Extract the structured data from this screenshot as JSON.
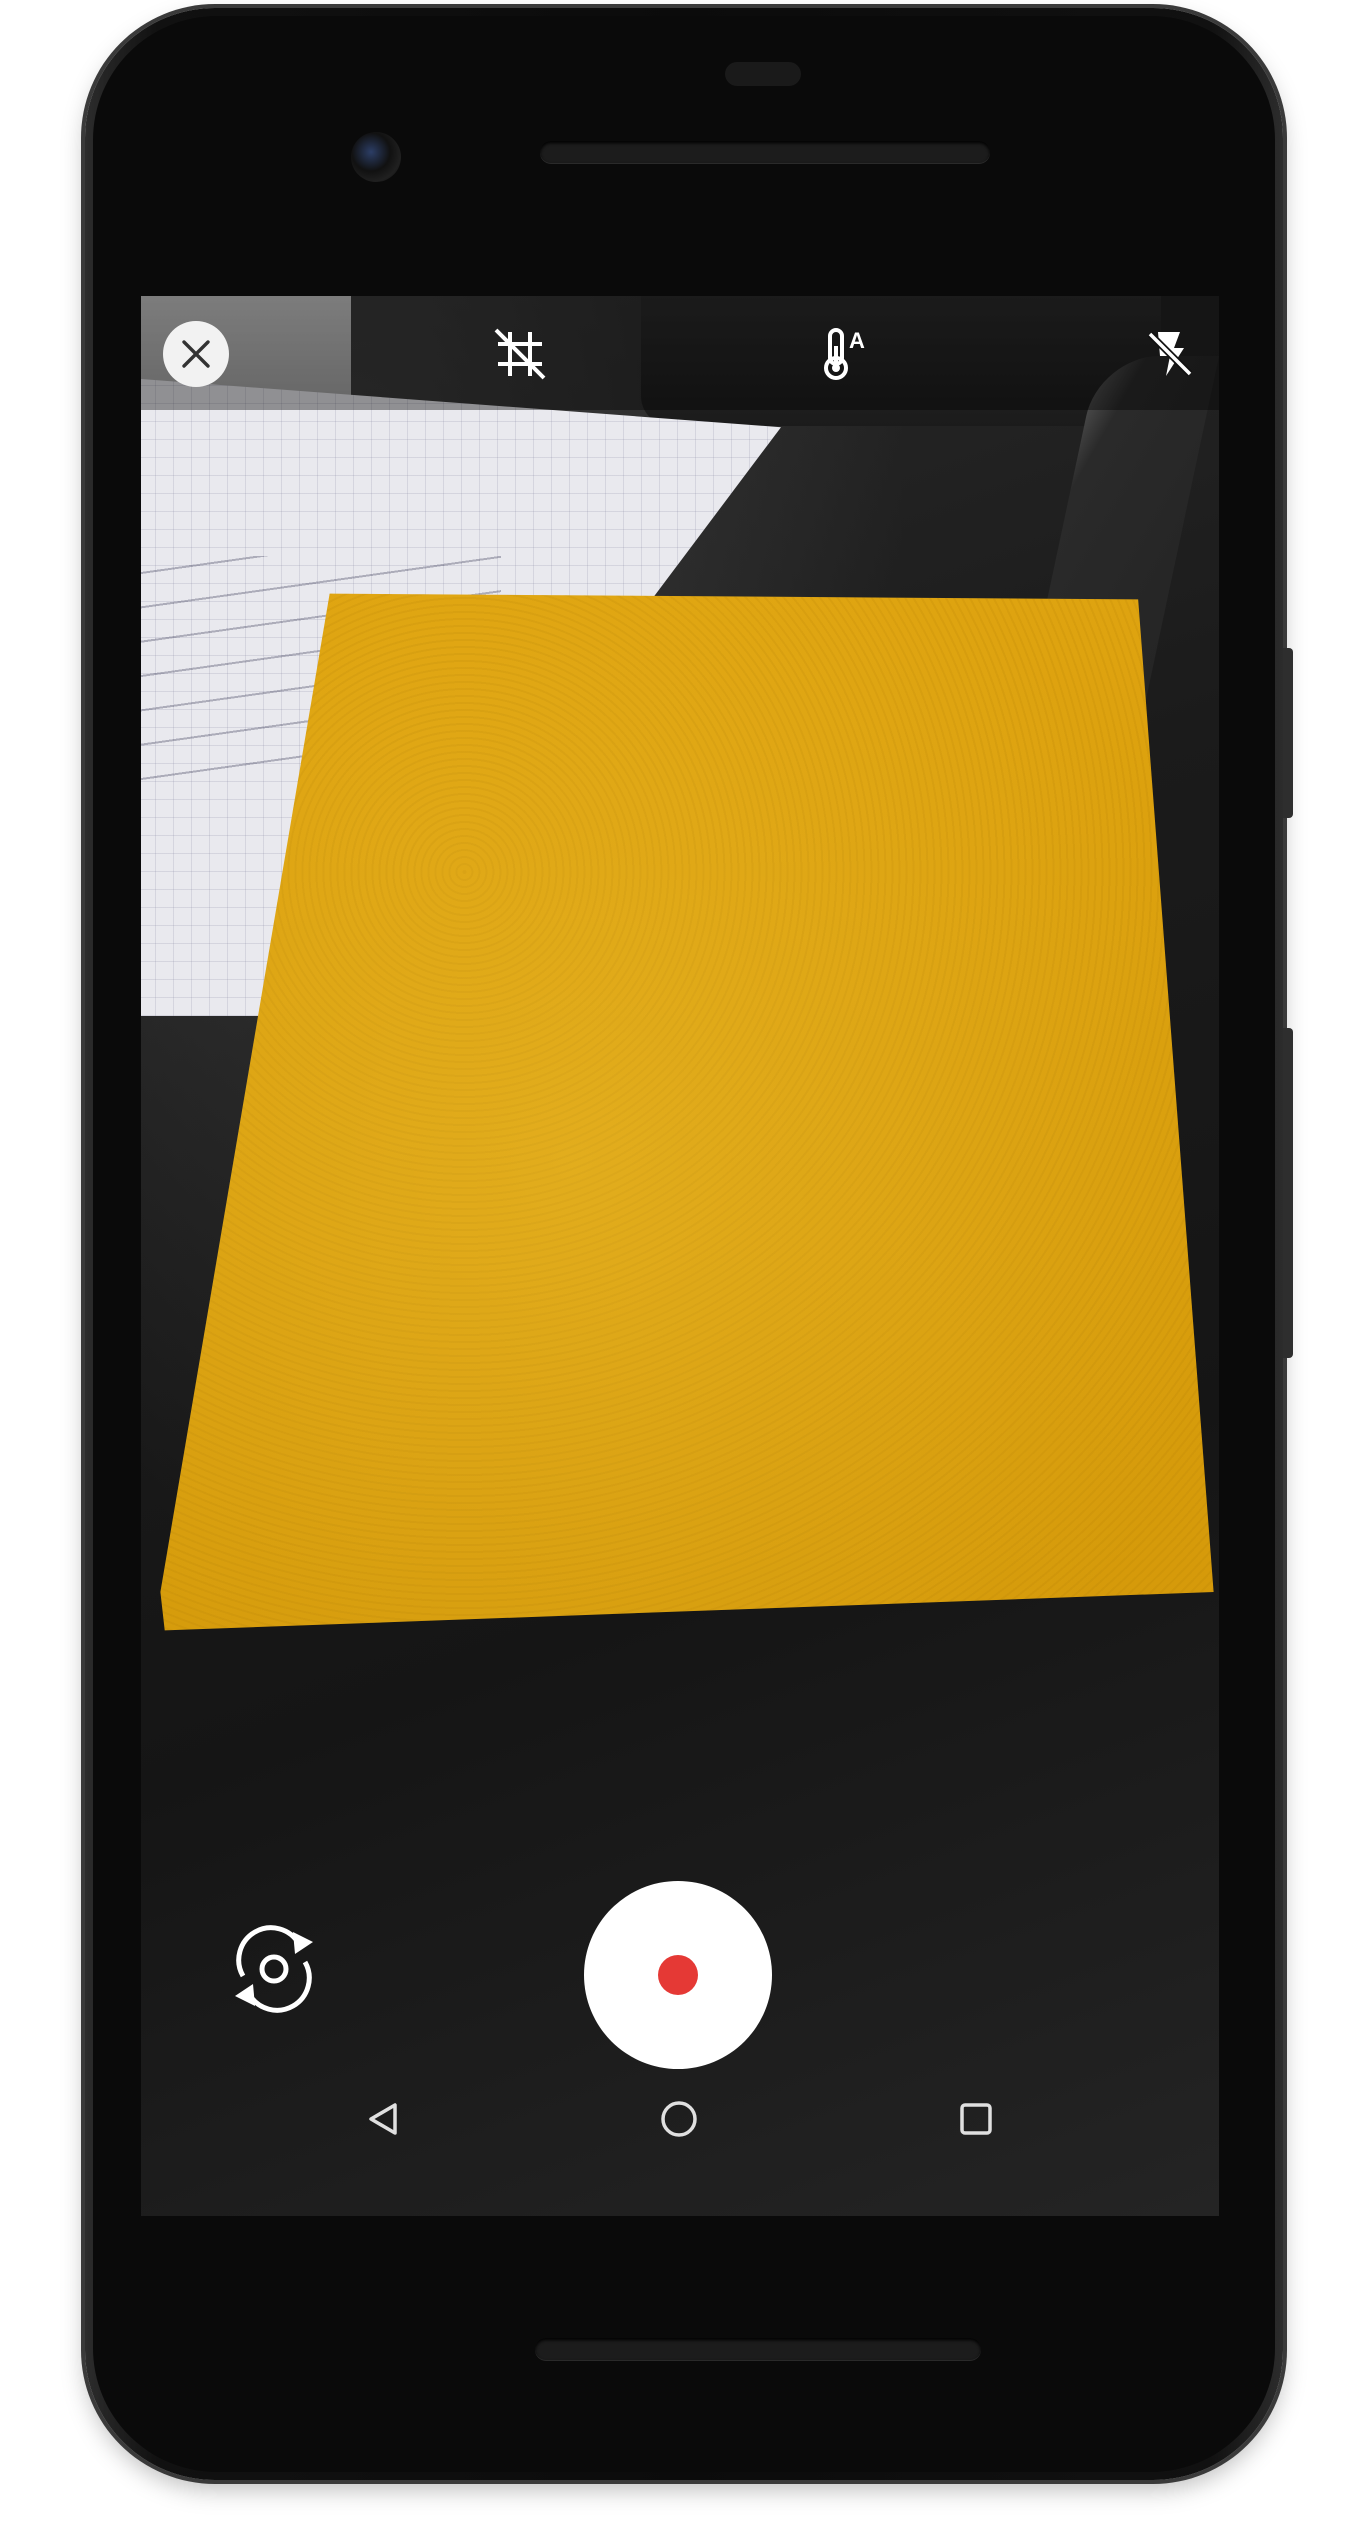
{
  "camera": {
    "top_controls": [
      {
        "icon": "close-icon"
      },
      {
        "icon": "grid-off-icon"
      },
      {
        "icon": "white-balance-auto-icon",
        "badge": "A"
      },
      {
        "icon": "flash-off-icon"
      }
    ],
    "bottom_controls": {
      "switch_camera_icon": "switch-camera-icon",
      "record_button_color": "#e53935"
    }
  },
  "nav_bar": {
    "items": [
      "back-icon",
      "home-icon",
      "recents-icon"
    ]
  },
  "colors": {
    "top_bar_overlay": "rgba(0,0,0,0.38)",
    "record_dot": "#e53935",
    "icon_color": "#ffffff"
  }
}
